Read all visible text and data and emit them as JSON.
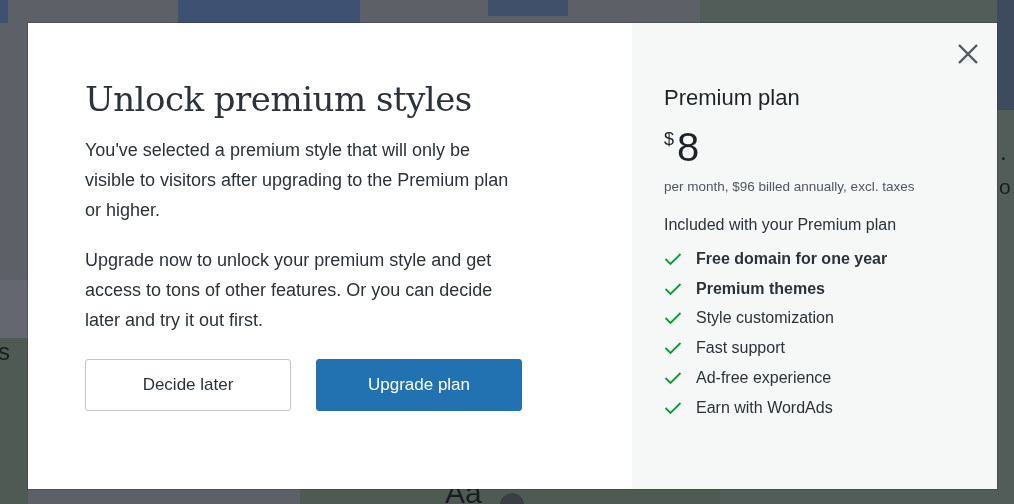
{
  "background_fragments": [
    {
      "text": "s",
      "kind": "left"
    },
    {
      "text": ".",
      "kind": "right-dot"
    },
    {
      "text": "o",
      "kind": "right"
    },
    {
      "text": "Aa",
      "kind": "bottom"
    }
  ],
  "dialog": {
    "title": "Unlock premium styles",
    "paragraphs": [
      "You've selected a premium style that will only be visible to visitors after upgrading to the Premium plan or higher.",
      "Upgrade now to unlock your premium style and get access to tons of other features. Or you can decide later and try it out first."
    ],
    "buttons": [
      {
        "label": "Decide later",
        "kind": "secondary"
      },
      {
        "label": "Upgrade plan",
        "kind": "primary"
      }
    ],
    "plan": {
      "name": "Premium plan",
      "currency": "$",
      "price": "8",
      "billing": "per month, $96 billed annually, excl. taxes",
      "included_heading": "Included with your Premium plan",
      "features": [
        {
          "label": "Free domain for one year",
          "emphasized": true
        },
        {
          "label": "Premium themes",
          "emphasized": true
        },
        {
          "label": "Style customization",
          "emphasized": false
        },
        {
          "label": "Fast support",
          "emphasized": false
        },
        {
          "label": "Ad-free experience",
          "emphasized": false
        },
        {
          "label": "Earn with WordAds",
          "emphasized": false
        }
      ]
    }
  }
}
